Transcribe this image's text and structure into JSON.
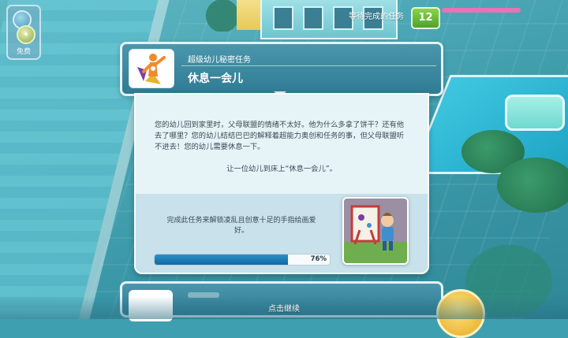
{
  "hud": {
    "free_label": "免费",
    "pending_label": "等待完成的任务",
    "pending_count": "12"
  },
  "task": {
    "subtitle": "超级幼儿秘密任务",
    "title": "休息一会儿",
    "description": "您的幼儿回到家里时，父母联盟的情绪不太好。他为什么多拿了饼干？还有他去了哪里？您的幼儿结结巴巴的解释着超能力奥创和任务的事，但父母联盟听不进去！您的幼儿需要休息一下。",
    "instruction": "让一位幼儿到床上“休息一会儿”。",
    "reward_text": "完成此任务来解锁凌乱且创意十足的手指绘画爱好。",
    "progress": 0.76,
    "progress_label": "76%"
  },
  "footer": {
    "continue_label": "点击继续"
  },
  "colors": {
    "header": "#2f7b93",
    "body": "#e6f3f7",
    "progress": "#1e7bb5",
    "badge": "#5fb23a"
  }
}
